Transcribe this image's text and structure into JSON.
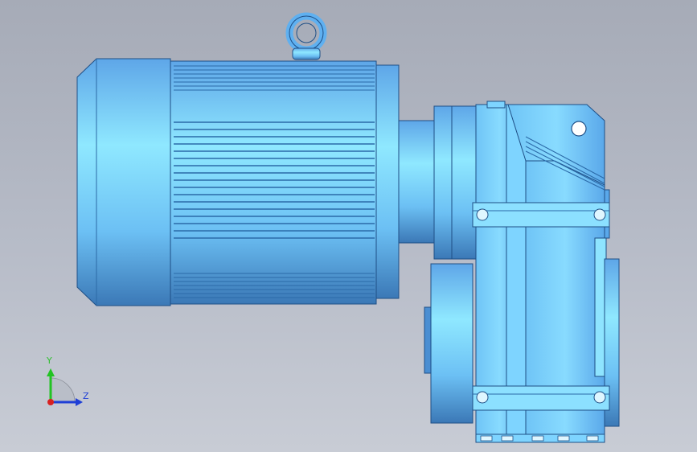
{
  "viewport": {
    "background_top": "#a6abb7",
    "background_bottom": "#c8ccd5"
  },
  "model": {
    "description_colors": {
      "body": "#5aa8f0",
      "highlight": "#8fe6ff",
      "shadow": "#3a78b8",
      "edge": "#1f4f86"
    },
    "parts": [
      "motor-end-cap",
      "motor-fins",
      "lifting-eye",
      "motor-flange",
      "coupling",
      "gearbox-housing",
      "mounting-strap-top",
      "mounting-strap-bottom",
      "output-flange",
      "gearbox-mount-bracket"
    ]
  },
  "triad": {
    "y_label": "Y",
    "z_label": "Z",
    "colors": {
      "y": "#22c322",
      "z": "#1f3fd6",
      "x": "#d82020"
    }
  }
}
